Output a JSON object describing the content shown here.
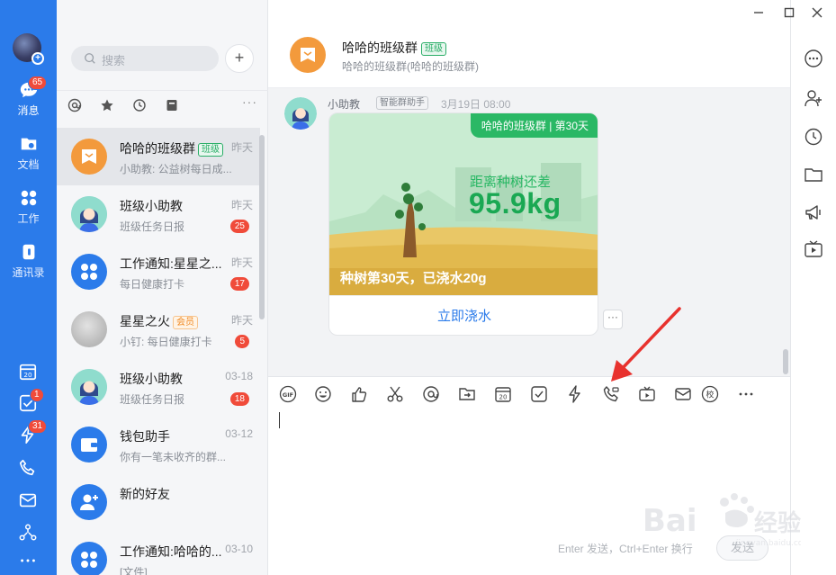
{
  "rail": {
    "messages": {
      "label": "消息",
      "badge": "65"
    },
    "docs": {
      "label": "文档"
    },
    "work": {
      "label": "工作"
    },
    "contacts": {
      "label": "通讯录"
    },
    "todo_badge": "1",
    "ding_badge": "31"
  },
  "search": {
    "placeholder": "搜索"
  },
  "add_button": "+",
  "filter_more": "···",
  "conversations": [
    {
      "name": "哈哈的班级群",
      "tag": "班级",
      "time": "昨天",
      "preview": "小助教: 公益树每日成...",
      "badge": ""
    },
    {
      "name": "班级小助教",
      "tag": "",
      "time": "昨天",
      "preview": "班级任务日报",
      "badge": "25"
    },
    {
      "name": "工作通知:星星之...",
      "tag": "",
      "time": "昨天",
      "preview": "每日健康打卡",
      "badge": "17"
    },
    {
      "name": "星星之火",
      "tag": "会员",
      "time": "昨天",
      "preview": "小钉: 每日健康打卡",
      "badge": "5"
    },
    {
      "name": "班级小助教",
      "tag": "",
      "time": "03-18",
      "preview": "班级任务日报",
      "badge": "18"
    },
    {
      "name": "钱包助手",
      "tag": "",
      "time": "03-12",
      "preview": "你有一笔未收齐的群...",
      "badge": ""
    },
    {
      "name": "新的好友",
      "tag": "",
      "time": "",
      "preview": "",
      "badge": ""
    },
    {
      "name": "工作通知:哈哈的...",
      "tag": "",
      "time": "03-10",
      "preview": "[文件]",
      "badge": ""
    }
  ],
  "chat": {
    "title": "哈哈的班级群",
    "title_tag": "班级",
    "subtitle": "哈哈的班级群(哈哈的班级群)",
    "sender": "小助教",
    "sender_tag": "智能群助手",
    "time": "3月19日 08:00",
    "card": {
      "tag": "哈哈的班级群 | 第30天",
      "label": "距离种树还差",
      "weight": "95.9kg",
      "progress": "种树第30天，已浇水20g",
      "action": "立即浇水"
    },
    "msg_more": "···",
    "hint": "Enter 发送，Ctrl+Enter 换行",
    "send": "发送"
  },
  "colors": {
    "rail": "#2b7bea",
    "green": "#2ab865",
    "badge": "#f04b3a",
    "arrow": "#e8322e"
  }
}
